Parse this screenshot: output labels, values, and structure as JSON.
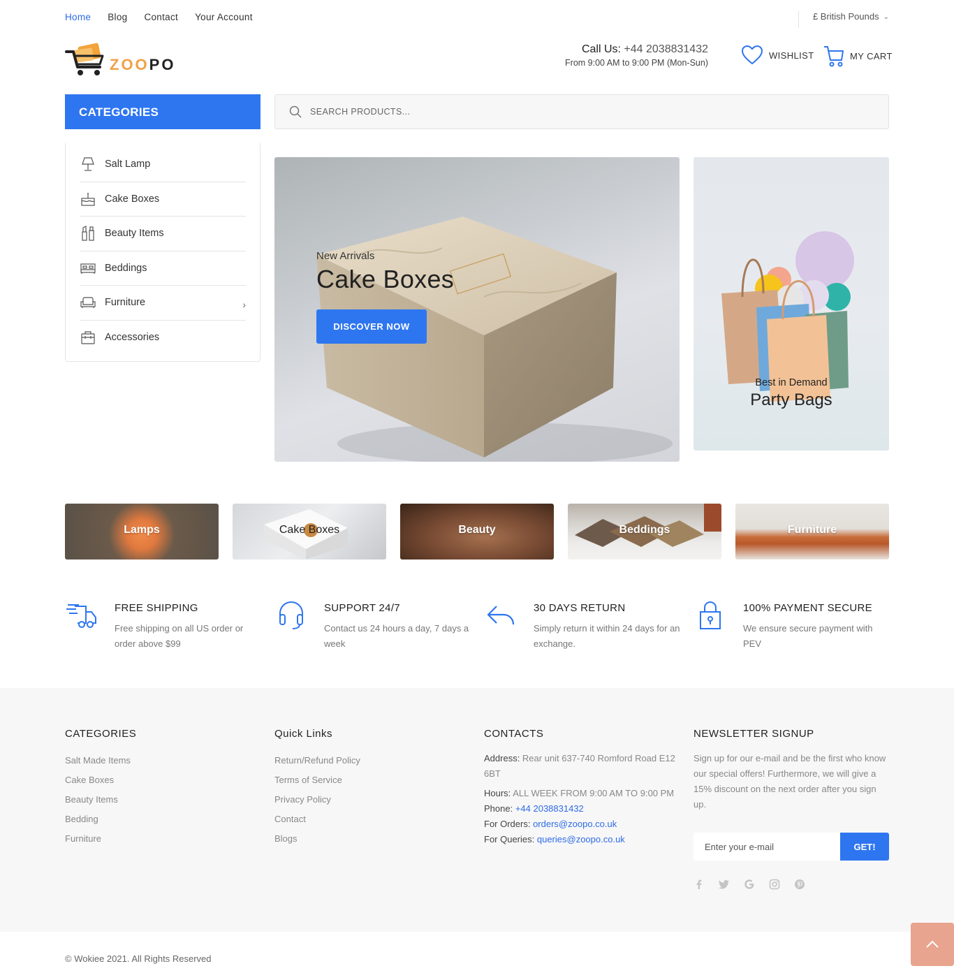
{
  "topnav": {
    "items": [
      "Home",
      "Blog",
      "Contact",
      "Your Account"
    ],
    "currency": "£  British Pounds"
  },
  "header": {
    "logo_text_1": "ZOO",
    "logo_text_2": "PO",
    "call_label": "Call Us: ",
    "call_number": "+44 2038831432",
    "hours": "From 9:00 AM to 9:00 PM (Mon-Sun)",
    "wishlist_label": "WISHLIST",
    "cart_label": "MY CART"
  },
  "categories": {
    "title": "CATEGORIES",
    "items": [
      {
        "label": "Salt Lamp",
        "icon": "lamp-icon"
      },
      {
        "label": "Cake Boxes",
        "icon": "cake-icon"
      },
      {
        "label": "Beauty Items",
        "icon": "cosmetics-icon"
      },
      {
        "label": "Beddings",
        "icon": "bed-icon"
      },
      {
        "label": "Furniture",
        "icon": "sofa-icon"
      },
      {
        "label": "Accessories",
        "icon": "bag-icon"
      }
    ]
  },
  "search": {
    "placeholder": "SEARCH PRODUCTS..."
  },
  "hero": {
    "subtitle": "New Arrivals",
    "title": "Cake Boxes",
    "button": "DISCOVER NOW"
  },
  "side_banner": {
    "subtitle": "Best in Demand",
    "title": "Party Bags"
  },
  "tiles": [
    "Lamps",
    "Cake Boxes",
    "Beauty",
    "Beddings",
    "Furniture"
  ],
  "features": [
    {
      "title": "FREE SHIPPING",
      "text": "Free shipping on all US order or order above $99",
      "icon": "truck-icon"
    },
    {
      "title": "SUPPORT 24/7",
      "text": "Contact us 24 hours a day, 7 days a week",
      "icon": "headset-icon"
    },
    {
      "title": "30 DAYS RETURN",
      "text": "Simply return it within 24 days for an exchange.",
      "icon": "return-icon"
    },
    {
      "title": "100% PAYMENT SECURE",
      "text": "We ensure secure payment with PEV",
      "icon": "lock-icon"
    }
  ],
  "footer": {
    "categories": {
      "title": "CATEGORIES",
      "items": [
        "Salt Made Items",
        "Cake Boxes",
        "Beauty Items",
        "Bedding",
        "Furniture"
      ]
    },
    "quick_links": {
      "title": "Quick Links",
      "items": [
        "Return/Refund Policy",
        "Terms of Service",
        "Privacy Policy",
        "Contact",
        "Blogs"
      ]
    },
    "contacts": {
      "title": "CONTACTS",
      "address_label": "Address: ",
      "address": "Rear unit 637-740 Romford Road E12 6BT",
      "hours_label": "Hours: ",
      "hours": "ALL WEEK FROM 9:00 AM TO 9:00 PM",
      "phone_label": "Phone: ",
      "phone": "+44 2038831432",
      "orders_label": "For Orders: ",
      "orders": "orders@zoopo.co.uk",
      "queries_label": "For Queries: ",
      "queries": "queries@zoopo.co.uk"
    },
    "newsletter": {
      "title": "NEWSLETTER SIGNUP",
      "text": "Sign up for our e-mail and be the first who know our special offers! Furthermore, we will give a 15% discount on the next order after you sign up.",
      "placeholder": "Enter your e-mail",
      "button": "GET!"
    },
    "socials": [
      "facebook-icon",
      "twitter-icon",
      "google-icon",
      "instagram-icon",
      "pinterest-icon"
    ]
  },
  "copyright": "© Wokiee 2021. All Rights Reserved",
  "colors": {
    "accent": "#2e76f0",
    "link": "#2e6be6",
    "to_top": "#e8a48e"
  }
}
